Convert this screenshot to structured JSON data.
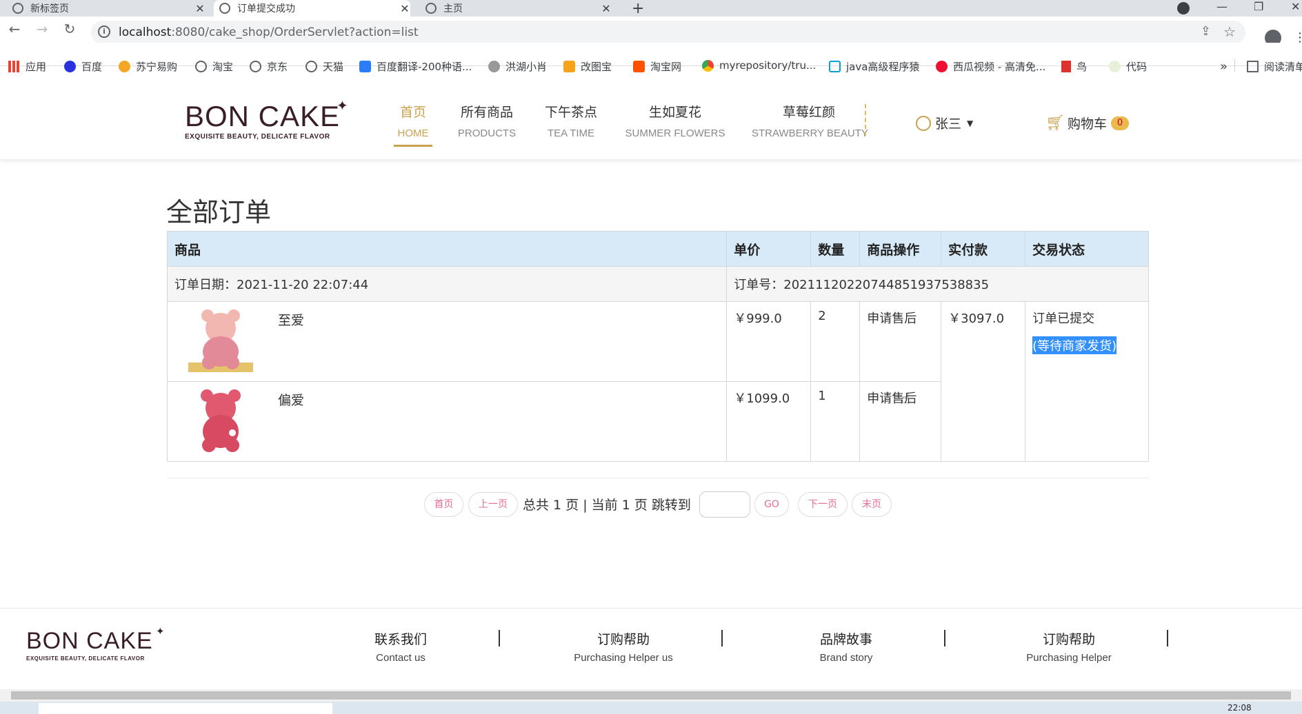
{
  "browser": {
    "tabs": [
      {
        "title": "新标签页"
      },
      {
        "title": "订单提交成功"
      },
      {
        "title": "主页"
      }
    ],
    "new_tab": "+",
    "url_host": "localhost",
    "url_rest": ":8080/cake_shop/OrderServlet?action=list",
    "bookmarks": [
      "应用",
      "百度",
      "苏宁易购",
      "淘宝",
      "京东",
      "天猫",
      "百度翻译-200种语...",
      "洪湖小肖",
      "改图宝",
      "淘宝网",
      "myrepository/tru...",
      "java高级程序猿",
      "西瓜视频 - 高清免...",
      "鸟",
      "代码"
    ],
    "bookmarks_more": "»",
    "reading_list": "阅读清单"
  },
  "site": {
    "logo": {
      "main": "BON CAKE",
      "sub": "EXQUISITE BEAUTY, DELICATE FLAVOR"
    },
    "nav": [
      {
        "zh": "首页",
        "en": "HOME"
      },
      {
        "zh": "所有商品",
        "en": "PRODUCTS"
      },
      {
        "zh": "下午茶点",
        "en": "TEA TIME"
      },
      {
        "zh": "生如夏花",
        "en": "SUMMER FLOWERS"
      },
      {
        "zh": "草莓红颜",
        "en": "STRAWBERRY BEAUTY"
      }
    ],
    "user": "张三",
    "cart_label": "购物车",
    "cart_count": "0",
    "accent_color": "#c9a14c"
  },
  "page": {
    "title": "全部订单",
    "columns": [
      "商品",
      "单价",
      "数量",
      "商品操作",
      "实付款",
      "交易状态"
    ],
    "order": {
      "date_label": "订单日期：2021-11-20 22:07:44",
      "no_label": "订单号：20211120220744851937538835",
      "total": "￥3097.0",
      "status": "订单已提交",
      "status_sub": "(等待商家发货)",
      "items": [
        {
          "name": "至爱",
          "price": "￥999.0",
          "qty": "2",
          "action": "申请售后"
        },
        {
          "name": "偏爱",
          "price": "￥1099.0",
          "qty": "1",
          "action": "申请售后"
        }
      ]
    },
    "pager": {
      "first": "首页",
      "prev": "上一页",
      "info": "总共 1 页 | 当前 1 页 跳转到",
      "go": "GO",
      "next": "下一页",
      "last": "末页"
    }
  },
  "footer": {
    "items": [
      {
        "zh": "联系我们",
        "en": "Contact us"
      },
      {
        "zh": "订购帮助",
        "en": "Purchasing Helper us"
      },
      {
        "zh": "品牌故事",
        "en": "Brand story"
      },
      {
        "zh": "订购帮助",
        "en": "Purchasing Helper"
      }
    ]
  },
  "taskbar": {
    "time": "22:08"
  }
}
